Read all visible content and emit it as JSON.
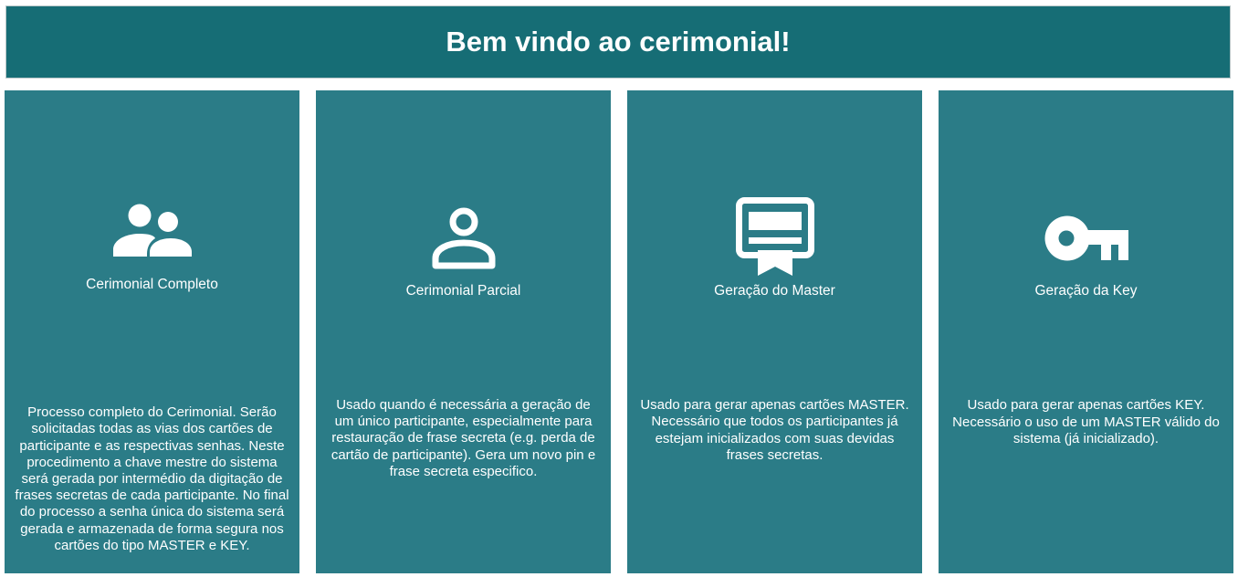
{
  "header": {
    "title": "Bem vindo ao cerimonial!"
  },
  "colors": {
    "header_bg": "#166d75",
    "card_bg": "#2b7c87",
    "text": "#ffffff"
  },
  "cards": [
    {
      "icon": "people-icon",
      "title": "Cerimonial Completo",
      "description": "Processo completo do Cerimonial. Serão solicitadas todas as vias dos cartões de participante e as respectivas senhas. Neste procedimento a chave mestre do sistema será gerada por intermédio da digitação de frases secretas de cada participante. No final do processo a senha única do sistema será gerada e armazenada de forma segura nos cartões do tipo MASTER e KEY."
    },
    {
      "icon": "person-icon",
      "title": "Cerimonial Parcial",
      "description": "Usado quando é necessária a geração de um único participante, especialmente para restauração de frase secreta (e.g. perda de cartão de participante). Gera um novo pin e frase secreta especifico."
    },
    {
      "icon": "certificate-icon",
      "title": "Geração do Master",
      "description": "Usado para gerar apenas cartões MASTER. Necessário que todos os participantes já estejam inicializados com suas devidas frases secretas."
    },
    {
      "icon": "key-icon",
      "title": "Geração da Key",
      "description": "Usado para gerar apenas cartões KEY. Necessário o uso de um MASTER válido do sistema (já inicializado)."
    }
  ]
}
